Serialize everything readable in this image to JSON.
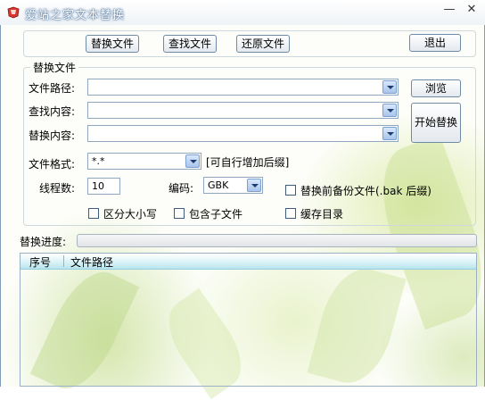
{
  "window": {
    "title": "爱站之家文本替换",
    "min_symbol": "—",
    "close_symbol": "✕"
  },
  "toolbar": {
    "replace_file": "替换文件",
    "find_file": "查找文件",
    "restore_file": "还原文件",
    "exit": "退出"
  },
  "replace_group": {
    "legend": "替换文件",
    "file_path_label": "文件路径:",
    "file_path_value": "",
    "find_label": "查找内容:",
    "find_value": "",
    "replace_label": "替换内容:",
    "replace_value": "",
    "browse": "浏览",
    "start_replace": "开始替换",
    "format_label": "文件格式:",
    "format_value": "*.*",
    "format_hint": "[可自行增加后缀]",
    "threads_label": "线程数:",
    "threads_value": "10",
    "encoding_label": "编码:",
    "encoding_value": "GBK",
    "backup_label": "替换前备份文件(.bak 后缀)",
    "case_label": "区分大小写",
    "subfiles_label": "包含子文件",
    "cache_label": "缓存目录"
  },
  "progress": {
    "label": "替换进度:",
    "value": 0
  },
  "list": {
    "columns": [
      "序号",
      "文件路径"
    ],
    "rows": []
  },
  "colors": {
    "accent": "#6f8aa3",
    "header_cyan": "#b8e4ee",
    "leaf_green": "#c4dc8c"
  }
}
